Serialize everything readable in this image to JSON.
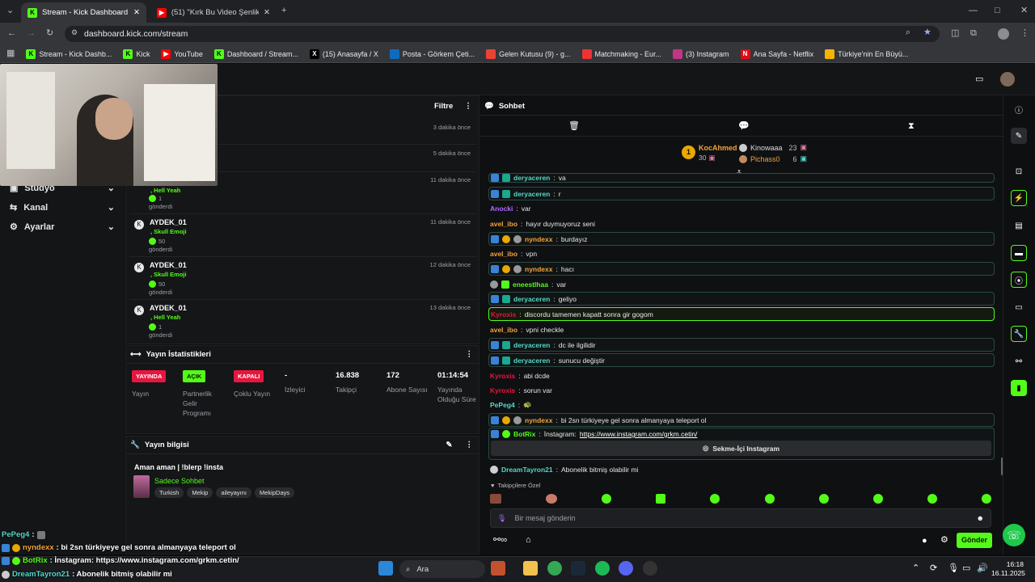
{
  "browser": {
    "tabs": [
      {
        "label": "Stream - Kick Dashboard",
        "icon": "K"
      },
      {
        "label": "(51) \"Kırk Bu Video Şenlik\" Kick",
        "icon": "▶"
      }
    ],
    "url": "dashboard.kick.com/stream",
    "bookmarks": [
      "Stream - Kick Dashb...",
      "Kick",
      "YouTube",
      "Dashboard / Stream...",
      "(15) Anasayfa / X",
      "Posta - Görkem Çeti...",
      "Gelen Kutusu (9) - g...",
      "Matchmaking - Eur...",
      "(3) Instagram",
      "Ana Sayfa - Netflix",
      "Türkiye'nin En Büyü..."
    ]
  },
  "sidebar": {
    "items": [
      {
        "label": "Stüdyo"
      },
      {
        "label": "Kanal"
      },
      {
        "label": "Ayarlar"
      }
    ]
  },
  "activity": {
    "filter_label": "Filtre",
    "events": [
      {
        "time": "3 dakika önce"
      },
      {
        "time": "5 dakika önce"
      },
      {
        "user": "",
        "item": ", Hell Yeah",
        "amount": "1",
        "verb": "gönderdi",
        "time": "11 dakika önce"
      },
      {
        "user": "AYDEK_01",
        "item": ", Skull Emoji",
        "amount": "50",
        "verb": "gönderdi",
        "time": "11 dakika önce"
      },
      {
        "user": "AYDEK_01",
        "item": ", Skull Emoji",
        "amount": "50",
        "verb": "gönderdi",
        "time": "12 dakika önce"
      },
      {
        "user": "AYDEK_01",
        "item": ", Hell Yeah",
        "amount": "1",
        "verb": "gönderdi",
        "time": "13 dakika önce"
      }
    ]
  },
  "stats": {
    "title": "Yayın İstatistikleri",
    "cols": [
      {
        "badge": "YAYINDA",
        "badge_color": "#e5173f",
        "label": "Yayın"
      },
      {
        "badge": "AÇIK",
        "badge_color": "#53fc18",
        "label": "Partnerlik Gelir Programı"
      },
      {
        "badge": "KAPALI",
        "badge_color": "#e5173f",
        "label": "Çoklu Yayın"
      },
      {
        "value": "-",
        "label": "İzleyici"
      },
      {
        "value": "16.838",
        "label": "Takipçi"
      },
      {
        "value": "172",
        "label": "Abone Sayısı"
      },
      {
        "value": "01:14:54",
        "label": "Yayında Olduğu Süre"
      }
    ]
  },
  "info": {
    "title": "Yayın bilgisi",
    "stream_title": "Aman aman | !blerp !insta",
    "category": "Sadece Sohbet",
    "tags": [
      "Turkish",
      "Mekip",
      "aileyayını",
      "MekipDays"
    ]
  },
  "chat": {
    "title": "Sohbet",
    "leaderboard": [
      {
        "rank": "1",
        "name": "KocAhmed",
        "score": "30"
      },
      {
        "name": "Kinowaaa",
        "score": "23"
      },
      {
        "name": "Pichass0",
        "score": "6"
      }
    ],
    "messages": [
      {
        "user": "deryaceren",
        "color": "#53d8c8",
        "text": "va",
        "style": "box",
        "badges": [
          "blue",
          "teal"
        ]
      },
      {
        "user": "deryaceren",
        "color": "#53d8c8",
        "text": "r",
        "style": "box",
        "badges": [
          "blue",
          "teal"
        ]
      },
      {
        "user": "Anocki",
        "color": "#b36bff",
        "text": "var",
        "style": "",
        "badges": []
      },
      {
        "user": "avel_ibo",
        "color": "#f3a33b",
        "text": "hayır duymuyoruz seni",
        "style": "",
        "badges": []
      },
      {
        "user": "nyndexx",
        "color": "#f3a33b",
        "text": "burdayız",
        "style": "box",
        "badges": [
          "blue",
          "gold",
          "av"
        ]
      },
      {
        "user": "avel_ibo",
        "color": "#f3a33b",
        "text": "vpn",
        "style": "",
        "badges": []
      },
      {
        "user": "nyndexx",
        "color": "#f3a33b",
        "text": "hacı",
        "style": "box",
        "badges": [
          "blue",
          "gold",
          "av"
        ]
      },
      {
        "user": "eneestlhaa",
        "color": "#53fc18",
        "text": "var",
        "style": "",
        "badges": [
          "av",
          "grn"
        ]
      },
      {
        "user": "deryaceren",
        "color": "#53d8c8",
        "text": "geliyo",
        "style": "box",
        "badges": [
          "blue",
          "teal"
        ]
      },
      {
        "user": "Kyroxis",
        "color": "#e5173f",
        "text": "discordu tamemen kapatt sonra gir gogom",
        "style": "hl",
        "badges": []
      },
      {
        "user": "avel_ibo",
        "color": "#f3a33b",
        "text": "vpni checkle",
        "style": "",
        "badges": []
      },
      {
        "user": "deryaceren",
        "color": "#53d8c8",
        "text": "dc ile ilgilidir",
        "style": "box",
        "badges": [
          "blue",
          "teal"
        ]
      },
      {
        "user": "deryaceren",
        "color": "#53d8c8",
        "text": "sunucu değiştir",
        "style": "box",
        "badges": [
          "blue",
          "teal"
        ]
      },
      {
        "user": "Kyroxis",
        "color": "#e5173f",
        "text": "abi dcde",
        "style": "",
        "badges": []
      },
      {
        "user": "Kyroxis",
        "color": "#e5173f",
        "text": "sorun var",
        "style": "",
        "badges": []
      },
      {
        "user": "PePeg4",
        "color": "#53d8c8",
        "text": "🐢",
        "style": "",
        "badges": []
      },
      {
        "user": "nyndexx",
        "color": "#f3a33b",
        "text": "bi 2sn türkiyeye gel sonra almanyaya teleport ol",
        "style": "box",
        "badges": [
          "blue",
          "gold",
          "av"
        ]
      }
    ],
    "botrix": {
      "user": "BotRix",
      "prefix": "İnstagram:",
      "link": "https://www.instagram.com/grkm.cetin/",
      "button": "Sekme-İçi Instagram"
    },
    "last": {
      "user": "DreamTayron21",
      "text": "Abonelik bitmiş olabilir mi"
    },
    "followers_label": "Takipçilere Özel",
    "input_placeholder": "Bir mesaj gönderin",
    "send_label": "Gönder"
  },
  "overlay": [
    {
      "user": "PePeg4",
      "text": ":"
    },
    {
      "user": "nyndexx",
      "text": ": bi 2sn türkiyeye gel sonra almanyaya teleport ol"
    },
    {
      "user": "BotRix",
      "text": ": İnstagram: https://www.instagram.com/grkm.cetin/"
    },
    {
      "user": "DreamTayron21",
      "text": ": Abonelik bitmiş olabilir mi"
    }
  ],
  "taskbar": {
    "search": "Ara",
    "time": "16:18",
    "date": "16.11.2025"
  }
}
